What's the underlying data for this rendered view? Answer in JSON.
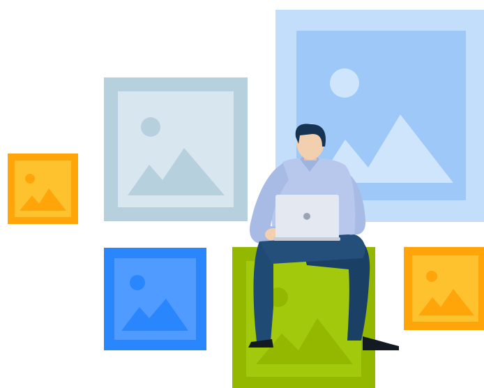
{
  "illustration": {
    "subject": "person-with-laptop",
    "icon_names": [
      "image-placeholder-icon",
      "laptop-icon",
      "person-figure"
    ],
    "colors": {
      "light_blue_frame": "#c3defa",
      "light_blue_inner": "#9dc8f8",
      "steel_frame": "#b7d0de",
      "steel_inner": "#d8e6ef",
      "blue_frame": "#2a86fd",
      "blue_inner": "#4f9bff",
      "orange_frame": "#ffa50a",
      "orange_inner": "#ffc22f",
      "green_frame": "#94b800",
      "green_inner": "#a3c90d",
      "shirt": "#b7c8ec",
      "pants": "#1f4a73",
      "skin": "#f2cfae",
      "hair": "#153352",
      "laptop": "#e4e8f0"
    }
  }
}
